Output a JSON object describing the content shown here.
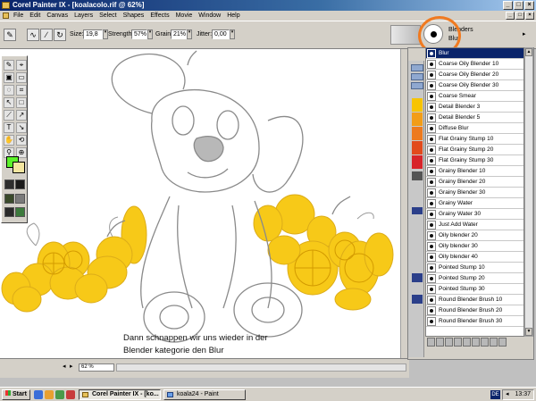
{
  "window": {
    "title": "Corel Painter IX - [koalacolo.rif @ 62%]",
    "controls": [
      "_",
      "□",
      "×"
    ]
  },
  "menu": {
    "items": [
      "File",
      "Edit",
      "Canvas",
      "Layers",
      "Select",
      "Shapes",
      "Effects",
      "Movie",
      "Window",
      "Help"
    ]
  },
  "property_bar": {
    "size_label": "Size:",
    "size_value": "19,8",
    "strength_label": "Strength:",
    "strength_value": "57%",
    "grain_label": "Grain:",
    "grain_value": "21%",
    "jitter_label": "Jitter:",
    "jitter_value": "0,00"
  },
  "brush_selector": {
    "category": "Blenders",
    "variant": "Blur"
  },
  "canvas": {
    "caption_line1": "Dann schnappen wir uns wieder in der",
    "caption_line2": "Blender kategorie den Blur",
    "fill_color": "#f7c400",
    "line_color": "#8a8a8a"
  },
  "toolbox": {
    "fg_color": "#5cf22a",
    "bg_color": "#f4e6a0"
  },
  "variants": [
    "Blur",
    "Coarse Oily Blender 10",
    "Coarse Oily Blender 20",
    "Coarse Oily Blender 30",
    "Coarse Smear",
    "Detail Blender 3",
    "Detail Blender 5",
    "Diffuse Blur",
    "Flat Grainy Stump 10",
    "Flat Grainy Stump 20",
    "Flat Grainy Stump 30",
    "Grainy Blender 10",
    "Grainy Blender 20",
    "Grainy Blender 30",
    "Grainy Water",
    "Grainy Water 30",
    "Just Add Water",
    "Oily blender 20",
    "Oily blender 30",
    "Oily blender 40",
    "Pointed Stump 10",
    "Pointed Stump 20",
    "Pointed Stump 30",
    "Round Blender Brush 10",
    "Round Blender Brush 20",
    "Round Blender Brush 30"
  ],
  "status": {
    "zoom": "62 %"
  },
  "taskbar": {
    "start": "Start",
    "task1": "Corel Painter IX - [ko...",
    "task2": "koala24 - Paint",
    "lang": "DE",
    "time": "13:37"
  }
}
